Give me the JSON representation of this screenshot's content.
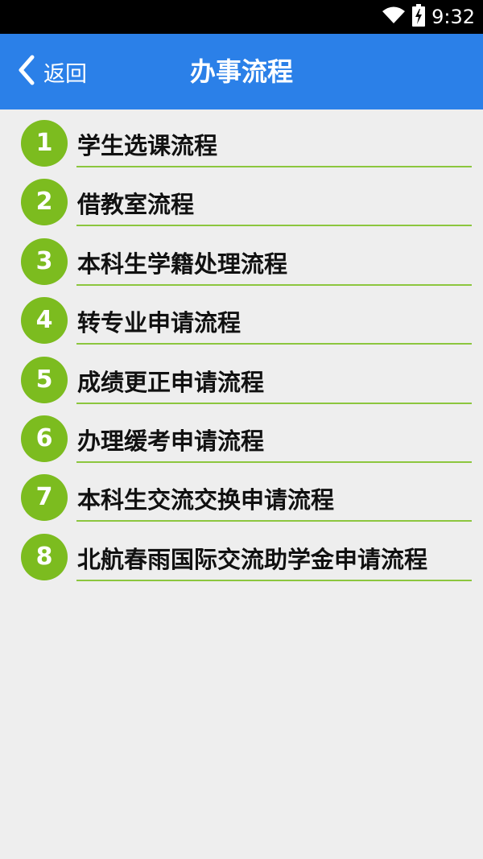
{
  "status_bar": {
    "time": "9:32",
    "icons": [
      "wifi-icon",
      "battery-charging-icon"
    ]
  },
  "header": {
    "back_label": "返回",
    "title": "办事流程"
  },
  "items": [
    {
      "number": "1",
      "label": "学生选课流程"
    },
    {
      "number": "2",
      "label": "借教室流程"
    },
    {
      "number": "3",
      "label": "本科生学籍处理流程"
    },
    {
      "number": "4",
      "label": "转专业申请流程"
    },
    {
      "number": "5",
      "label": "成绩更正申请流程"
    },
    {
      "number": "6",
      "label": "办理缓考申请流程"
    },
    {
      "number": "7",
      "label": "本科生交流交换申请流程"
    },
    {
      "number": "8",
      "label": "北航春雨国际交流助学金申请流程"
    }
  ],
  "colors": {
    "nav_bar": "#2b80e8",
    "badge": "#7cbc1f",
    "divider": "#8cc63e",
    "background": "#eeeeee"
  }
}
